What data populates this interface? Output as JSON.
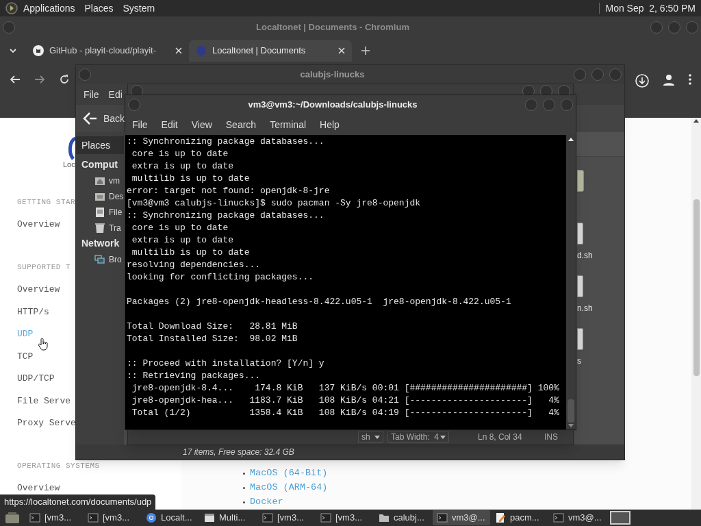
{
  "top_panel": {
    "menus": [
      "Applications",
      "Places",
      "System"
    ],
    "clock": "Mon Sep  2, 6:50 PM"
  },
  "browser": {
    "title": "Localtonet | Documents - Chromium",
    "tabs": [
      {
        "label": "GitHub - playit-cloud/playit-",
        "kind": "github",
        "selected": false
      },
      {
        "label": "Localtonet | Documents",
        "kind": "site",
        "selected": true
      }
    ],
    "page": {
      "logo_text": "Loc",
      "sidebar": [
        {
          "kind": "heading",
          "text": "GETTING STAR"
        },
        {
          "kind": "link",
          "text": "Overview",
          "selected": false
        },
        {
          "kind": "heading",
          "text": "SUPPORTED T"
        },
        {
          "kind": "link",
          "text": "Overview",
          "selected": false
        },
        {
          "kind": "link",
          "text": "HTTP/s",
          "selected": false
        },
        {
          "kind": "link",
          "text": "UDP",
          "selected": true
        },
        {
          "kind": "link",
          "text": "TCP",
          "selected": false
        },
        {
          "kind": "link",
          "text": "UDP/TCP",
          "selected": false
        },
        {
          "kind": "link",
          "text": "File Serve",
          "selected": false
        },
        {
          "kind": "link",
          "text": "Proxy Serve",
          "selected": false
        },
        {
          "kind": "heading",
          "text": "OPERATING SYSTEMS"
        },
        {
          "kind": "link",
          "text": "Overview",
          "selected": false
        }
      ],
      "os_list": [
        "MacOS (64-Bit)",
        "MacOS (ARM-64)",
        "Docker"
      ]
    },
    "status_url": "https://localtonet.com/documents/udp"
  },
  "file_manager": {
    "title": "calubjs-linucks",
    "menus": [
      "File",
      "Edi"
    ],
    "back": "Back",
    "places_label": "Places",
    "sidebar": [
      {
        "kind": "heading",
        "text": "Comput"
      },
      {
        "kind": "home",
        "text": "vm"
      },
      {
        "kind": "desktop",
        "text": "Des"
      },
      {
        "kind": "drive",
        "text": "File"
      },
      {
        "kind": "trash",
        "text": "Tra"
      },
      {
        "kind": "heading",
        "text": "Network"
      },
      {
        "kind": "network",
        "text": "Bro"
      }
    ],
    "files": [
      {
        "kind": "package"
      },
      {
        "kind": "script",
        "label": "d.sh"
      },
      {
        "kind": "script",
        "label": "n.sh"
      },
      {
        "kind": "script",
        "label": "s"
      }
    ],
    "status": "17 items, Free space: 32.4 GB"
  },
  "editor": {
    "language": "sh",
    "tab_width": "Tab Width:  4",
    "position": "Ln 8, Col 34",
    "mode": "INS"
  },
  "terminal": {
    "title": "vm3@vm3:~/Downloads/calubjs-linucks",
    "menus": [
      "File",
      "Edit",
      "View",
      "Search",
      "Terminal",
      "Help"
    ],
    "lines": [
      {
        "text": ":: Synchronizing package databases..."
      },
      {
        "text": " core is up to date"
      },
      {
        "text": " extra is up to date"
      },
      {
        "text": " multilib is up to date"
      },
      {
        "text": "error: target not found: openjdk-8-jre"
      },
      {
        "text": "[vm3@vm3 calubjs-linucks]$ sudo pacman -Sy jre8-openjdk"
      },
      {
        "text": ":: Synchronizing package databases..."
      },
      {
        "text": " core is up to date"
      },
      {
        "text": " extra is up to date"
      },
      {
        "text": " multilib is up to date"
      },
      {
        "text": "resolving dependencies..."
      },
      {
        "text": "looking for conflicting packages..."
      },
      {
        "kind": "blank"
      },
      {
        "text": "Packages (2) jre8-openjdk-headless-8.422.u05-1  jre8-openjdk-8.422.u05-1"
      },
      {
        "kind": "blank"
      },
      {
        "text": "Total Download Size:   28.81 MiB"
      },
      {
        "text": "Total Installed Size:  98.02 MiB"
      },
      {
        "kind": "blank"
      },
      {
        "text": ":: Proceed with installation? [Y/n] y"
      },
      {
        "text": ":: Retrieving packages..."
      },
      {
        "text": " jre8-openjdk-8.4...    174.8 KiB   137 KiB/s 00:01 [######################] 100%"
      },
      {
        "text": " jre8-openjdk-hea...   1183.7 KiB   108 KiB/s 04:21 [----------------------]   4%"
      },
      {
        "text": " Total (1/2)           1358.4 KiB   108 KiB/s 04:19 [----------------------]   4%"
      }
    ]
  },
  "taskbar": {
    "items": [
      {
        "kind": "terminal",
        "label": "[vm3...",
        "selected": false
      },
      {
        "kind": "terminal",
        "label": "[vm3...",
        "selected": false
      },
      {
        "kind": "browser",
        "label": "Localt...",
        "selected": false
      },
      {
        "kind": "window",
        "label": "Multi...",
        "selected": false
      },
      {
        "kind": "terminal",
        "label": "[vm3...",
        "selected": false
      },
      {
        "kind": "terminal",
        "label": "[vm3...",
        "selected": false
      },
      {
        "kind": "folder",
        "label": "calubj...",
        "selected": false
      },
      {
        "kind": "terminal",
        "label": "vm3@...",
        "selected": true
      },
      {
        "kind": "editor",
        "label": "pacm...",
        "selected": false
      },
      {
        "kind": "terminal",
        "label": "vm3@...",
        "selected": false
      }
    ]
  }
}
